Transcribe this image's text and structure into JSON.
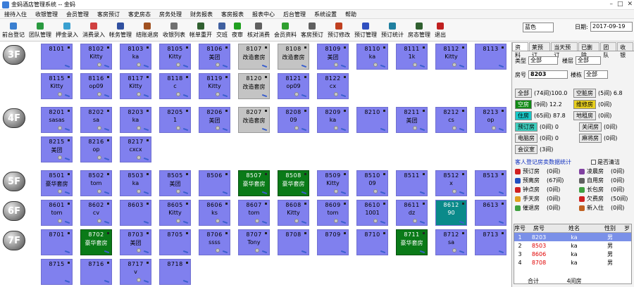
{
  "window": {
    "title": "金蚂酒店管理系统 -- 金蚂"
  },
  "menu": [
    "接待入住",
    "收银管理",
    "会员管理",
    "客房预订",
    "客史房态",
    "房务处理",
    "财务报表",
    "客房报表",
    "报表中心",
    "后台管理",
    "系统设置",
    "帮助"
  ],
  "toolbar": [
    {
      "label": "前台登记",
      "icon": "register-icon",
      "color": "#3a7fd0"
    },
    {
      "label": "团队管理",
      "icon": "team-icon",
      "color": "#2a9a40"
    },
    {
      "label": "押金录入",
      "icon": "deposit-icon",
      "color": "#3aa0d0"
    },
    {
      "label": "消费录入",
      "icon": "consume-icon",
      "color": "#d04040"
    },
    {
      "label": "帐务管理",
      "icon": "account-icon",
      "color": "#3050a0"
    },
    {
      "label": "结账退房",
      "icon": "checkout-icon",
      "color": "#a05020"
    },
    {
      "label": "收银列表",
      "icon": "cashier-icon",
      "color": "#707070"
    },
    {
      "label": "帐单重开",
      "icon": "reopen-icon",
      "color": "#306030"
    },
    {
      "label": "交班",
      "icon": "shift-icon",
      "color": "#4060a0"
    },
    {
      "label": "夜审",
      "icon": "audit-icon",
      "color": "#20a020"
    },
    {
      "label": "核对消费",
      "icon": "check-icon",
      "color": "#606060"
    },
    {
      "label": "会员资料",
      "icon": "member-icon",
      "color": "#30a030"
    },
    {
      "label": "客房预订",
      "icon": "book-icon",
      "color": "#606060"
    },
    {
      "label": "预订修改",
      "icon": "edit-book-icon",
      "color": "#c04020"
    },
    {
      "label": "预订管理",
      "icon": "book-manage-icon",
      "color": "#3050c0"
    },
    {
      "label": "预订统计",
      "icon": "book-stat-icon",
      "color": "#2080a0"
    },
    {
      "label": "房态管理",
      "icon": "room-status-icon",
      "color": "#306030"
    },
    {
      "label": "退出",
      "icon": "exit-icon",
      "color": "#c02020"
    }
  ],
  "skin": "蓝色",
  "date_label": "日期:",
  "date_value": "2017-09-19",
  "floors": [
    {
      "label": "3F",
      "rooms": [
        {
          "num": "8101",
          "name": "",
          "st": "purple"
        },
        {
          "num": "8102",
          "name": "Kitty",
          "st": "purple"
        },
        {
          "num": "8103",
          "name": "ka",
          "st": "purple"
        },
        {
          "num": "8105",
          "name": "Kitty",
          "st": "purple"
        },
        {
          "num": "8106",
          "name": "美团",
          "st": "purple"
        },
        {
          "num": "8107",
          "name": "改造套房",
          "st": "gray"
        },
        {
          "num": "8108",
          "name": "改造套房",
          "st": "gray"
        },
        {
          "num": "8109",
          "name": "美团",
          "st": "purple"
        },
        {
          "num": "8110",
          "name": "ka",
          "st": "purple"
        },
        {
          "num": "8111",
          "name": "1k",
          "st": "purple"
        },
        {
          "num": "8112",
          "name": "Kitty",
          "st": "purple"
        },
        {
          "num": "8113",
          "name": "",
          "st": "purple"
        },
        {
          "num": "8115",
          "name": "Kitty",
          "st": "purple"
        },
        {
          "num": "8116",
          "name": "op09",
          "st": "purple"
        },
        {
          "num": "8117",
          "name": "Kitty",
          "st": "purple"
        },
        {
          "num": "8118",
          "name": "c",
          "st": "purple"
        },
        {
          "num": "8119",
          "name": "Kitty",
          "st": "purple"
        },
        {
          "num": "8120",
          "name": "改造套房",
          "st": "gray"
        },
        {
          "num": "8121",
          "name": "op09",
          "st": "purple"
        },
        {
          "num": "8122",
          "name": "cx",
          "st": "purple"
        }
      ]
    },
    {
      "label": "4F",
      "rooms": [
        {
          "num": "8201",
          "name": "sasas",
          "st": "purple"
        },
        {
          "num": "8202",
          "name": "sa",
          "st": "purple"
        },
        {
          "num": "8203",
          "name": "ka",
          "st": "purple"
        },
        {
          "num": "8205",
          "name": "1",
          "st": "purple"
        },
        {
          "num": "8206",
          "name": "美团",
          "st": "purple"
        },
        {
          "num": "8207",
          "name": "改造套房",
          "st": "gray"
        },
        {
          "num": "8208",
          "name": "09",
          "st": "purple"
        },
        {
          "num": "8209",
          "name": "ka",
          "st": "purple"
        },
        {
          "num": "8210",
          "name": "",
          "st": "purple"
        },
        {
          "num": "8211",
          "name": "美团",
          "st": "purple"
        },
        {
          "num": "8212",
          "name": "cs",
          "st": "purple"
        },
        {
          "num": "8213",
          "name": "op",
          "st": "purple"
        },
        {
          "num": "8215",
          "name": "美团",
          "st": "purple"
        },
        {
          "num": "8216",
          "name": "op",
          "st": "purple"
        },
        {
          "num": "8217",
          "name": "cxcx",
          "st": "purple"
        }
      ]
    },
    {
      "label": "5F",
      "rooms": [
        {
          "num": "8501",
          "name": "豪华套房",
          "st": "purple"
        },
        {
          "num": "8502",
          "name": "tom",
          "st": "purple"
        },
        {
          "num": "8503",
          "name": "ka",
          "st": "purple"
        },
        {
          "num": "8505",
          "name": "美团",
          "st": "purple"
        },
        {
          "num": "8506",
          "name": "",
          "st": "purple"
        },
        {
          "num": "8507",
          "name": "豪华套房",
          "st": "green"
        },
        {
          "num": "8508",
          "name": "豪华套房",
          "st": "green"
        },
        {
          "num": "8509",
          "name": "Kitty",
          "st": "purple"
        },
        {
          "num": "8510",
          "name": "09",
          "st": "purple"
        },
        {
          "num": "8511",
          "name": "",
          "st": "purple"
        },
        {
          "num": "8512",
          "name": "x",
          "st": "purple"
        },
        {
          "num": "8513",
          "name": "",
          "st": "purple"
        }
      ]
    },
    {
      "label": "6F",
      "rooms": [
        {
          "num": "8601",
          "name": "tom",
          "st": "purple"
        },
        {
          "num": "8602",
          "name": "cv",
          "st": "purple"
        },
        {
          "num": "8603",
          "name": "",
          "st": "purple"
        },
        {
          "num": "8605",
          "name": "Kitty",
          "st": "purple"
        },
        {
          "num": "8606",
          "name": "ks",
          "st": "purple"
        },
        {
          "num": "8607",
          "name": "tom",
          "st": "purple"
        },
        {
          "num": "8608",
          "name": "Kitty",
          "st": "purple"
        },
        {
          "num": "8609",
          "name": "tom",
          "st": "purple"
        },
        {
          "num": "8610",
          "name": "1001",
          "st": "purple"
        },
        {
          "num": "8611",
          "name": "dz",
          "st": "purple"
        },
        {
          "num": "8612",
          "name": "90",
          "st": "teal"
        },
        {
          "num": "8613",
          "name": "",
          "st": "purple"
        }
      ]
    },
    {
      "label": "7F",
      "rooms": [
        {
          "num": "8701",
          "name": "",
          "st": "purple"
        },
        {
          "num": "8702",
          "name": "豪华套房",
          "st": "green"
        },
        {
          "num": "8703",
          "name": "美团",
          "st": "purple"
        },
        {
          "num": "8705",
          "name": "",
          "st": "purple"
        },
        {
          "num": "8706",
          "name": "ssss",
          "st": "purple"
        },
        {
          "num": "8707",
          "name": "Tony",
          "st": "purple"
        },
        {
          "num": "8708",
          "name": "",
          "st": "purple"
        },
        {
          "num": "8709",
          "name": "",
          "st": "purple"
        },
        {
          "num": "8710",
          "name": "",
          "st": "purple"
        },
        {
          "num": "8711",
          "name": "豪华套房",
          "st": "green"
        },
        {
          "num": "8712",
          "name": "sa",
          "st": "purple"
        },
        {
          "num": "8713",
          "name": "",
          "st": "purple"
        },
        {
          "num": "8715",
          "name": "",
          "st": "purple"
        },
        {
          "num": "8716",
          "name": "",
          "st": "purple"
        },
        {
          "num": "8717",
          "name": "v",
          "st": "purple"
        },
        {
          "num": "8718",
          "name": "",
          "st": "purple"
        }
      ]
    }
  ],
  "panel": {
    "tabs": [
      "资料",
      "莱预订",
      "当天预订",
      "已删除",
      "团队",
      "收银"
    ],
    "type_label": "类型",
    "type_value": "全部",
    "floor_label": "楼层",
    "floor_value": "全部",
    "room_label": "房号",
    "room_value": "8203",
    "building_label": "楼栋",
    "building_value": "全部",
    "stats": [
      {
        "label": "全部",
        "count": "(74间)100.0",
        "cls": "plain",
        "label2": "空脏房",
        "count2": "(5间) 6.8",
        "cls2": "plain"
      },
      {
        "label": "空房",
        "count": "(9间) 12.2",
        "cls": "green",
        "label2": "维修房",
        "count2": "(0间)",
        "cls2": "yellow"
      },
      {
        "label": "住房",
        "count": "(65间) 87.8",
        "cls": "cyan",
        "label2": "地租房",
        "count2": "(0间)",
        "cls2": "plain"
      },
      {
        "label": "预订房",
        "count": "(0间) 0",
        "cls": "teal",
        "label2": "关闭房",
        "count2": "(0间)",
        "cls2": "plain"
      },
      {
        "label": "电脑房",
        "count": "(0间) 0",
        "cls": "plain",
        "label2": "麻将房",
        "count2": "(0间)",
        "cls2": "plain"
      },
      {
        "label": "会议室",
        "count": "(3间)",
        "cls": "plain",
        "label2": "",
        "count2": "",
        "cls2": "plain"
      }
    ],
    "link_text": "客人登记房卖数据统计",
    "checkbox_label": "是否清洁",
    "legend": [
      {
        "l": "预订房",
        "c": "(0间)",
        "l2": "凌晨房",
        "c2": "(0间)",
        "ic": "#d02020",
        "ic2": "#8040a0"
      },
      {
        "l": "预离房",
        "c": "(67间)",
        "l2": "自用房",
        "c2": "(0间)",
        "ic": "#2050c0",
        "ic2": "#606060"
      },
      {
        "l": "钟点房",
        "c": "(0间)",
        "l2": "长包房",
        "c2": "(0间)",
        "ic": "#d02020",
        "ic2": "#40a040"
      },
      {
        "l": "手天房",
        "c": "(0间)",
        "l2": "欠费房",
        "c2": "(50间)",
        "ic": "#e0a020",
        "ic2": "#d02020"
      },
      {
        "l": "催退房",
        "c": "(0间)",
        "l2": "新入住",
        "c2": "(0间)",
        "ic": "#40a040",
        "ic2": "#c06020"
      }
    ],
    "table": {
      "headers": [
        "序号",
        "房号",
        "姓名",
        "性别",
        "岁"
      ],
      "rows": [
        {
          "i": "1",
          "room": "8203",
          "name": "ka",
          "sex": "男"
        },
        {
          "i": "2",
          "room": "8503",
          "name": "ka",
          "sex": "男"
        },
        {
          "i": "3",
          "room": "8606",
          "name": "ka",
          "sex": "男"
        },
        {
          "i": "4",
          "room": "8708",
          "name": "ka",
          "sex": "男"
        }
      ],
      "total_label": "合计",
      "total_value": "4间房"
    }
  }
}
